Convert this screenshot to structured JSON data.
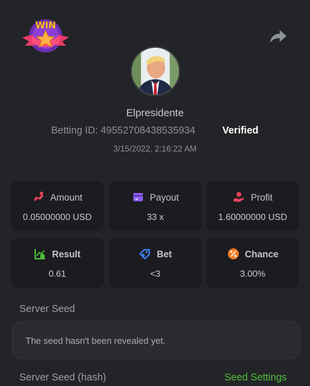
{
  "header": {
    "logo_icon": "win-star-badge-icon",
    "share_icon": "share-arrow-icon"
  },
  "profile": {
    "avatar": "user-avatar",
    "username": "Elpresidente",
    "betting_id_label": "Betting ID: 49552708438535934",
    "verified_label": "Verified",
    "timestamp": "3/15/2022, 2:16:22 AM"
  },
  "stats": [
    {
      "label": "Amount",
      "value": "0.05000000 USD",
      "icon": "coins-icon",
      "color": "#e8445a"
    },
    {
      "label": "Payout",
      "value": "33 x",
      "icon": "wallet-icon",
      "color": "#8b5cf6"
    },
    {
      "label": "Profit",
      "value": "1.60000000 USD",
      "icon": "hand-coin-icon",
      "color": "#e8445a"
    },
    {
      "label": "Result",
      "value": "0.61",
      "icon": "chart-check-icon",
      "color": "#4fbf3b"
    },
    {
      "label": "Bet",
      "value": "<3",
      "icon": "tag-icon",
      "color": "#3b82f6"
    },
    {
      "label": "Chance",
      "value": "3.00%",
      "icon": "percent-icon",
      "color": "#f07a22"
    }
  ],
  "server_seed": {
    "label": "Server Seed",
    "message": "The seed hasn't been revealed yet."
  },
  "server_seed_hash": {
    "label": "Server Seed (hash)",
    "settings_link": "Seed Settings"
  }
}
